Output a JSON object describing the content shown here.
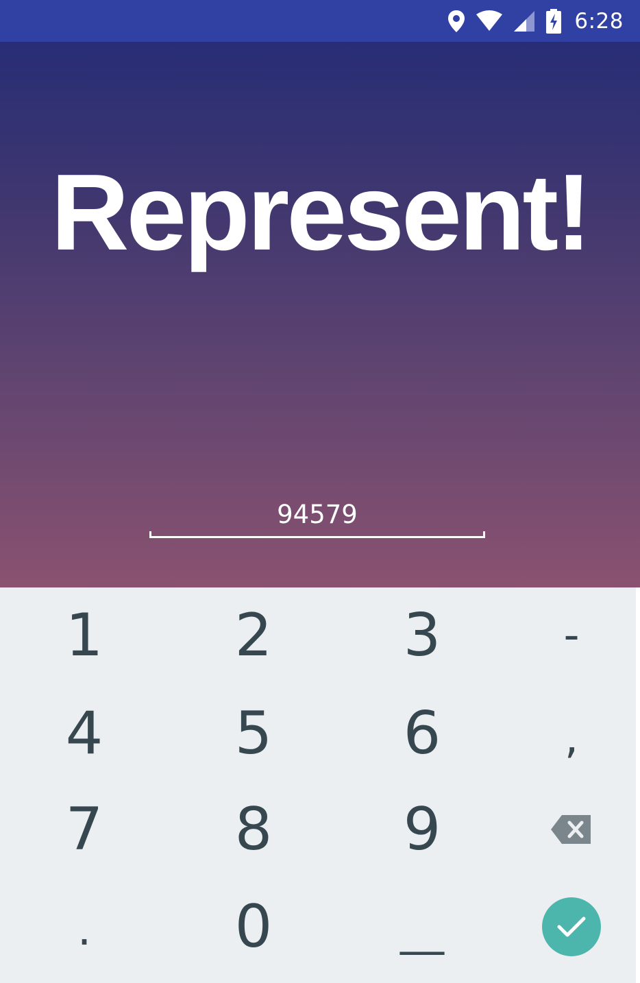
{
  "status_bar": {
    "time": "6:28",
    "icons": [
      "location-icon",
      "wifi-icon",
      "cell-signal-icon",
      "battery-charging-icon"
    ],
    "background_color": "#3141a3"
  },
  "app": {
    "title": "Represent!",
    "gradient_colors": [
      "#282d76",
      "#8a5270"
    ]
  },
  "zip_input": {
    "value": "94579"
  },
  "keypad": {
    "keys": {
      "k1": "1",
      "k2": "2",
      "k3": "3",
      "dash": "-",
      "k4": "4",
      "k5": "5",
      "k6": "6",
      "comma": ",",
      "k7": "7",
      "k8": "8",
      "k9": "9",
      "dot": ".",
      "k0": "0",
      "underscore": "__"
    },
    "backspace_icon": "backspace-icon",
    "done_icon": "check-icon",
    "done_color": "#4db6ac",
    "background_color": "#eceff1",
    "key_text_color": "#37474f"
  }
}
